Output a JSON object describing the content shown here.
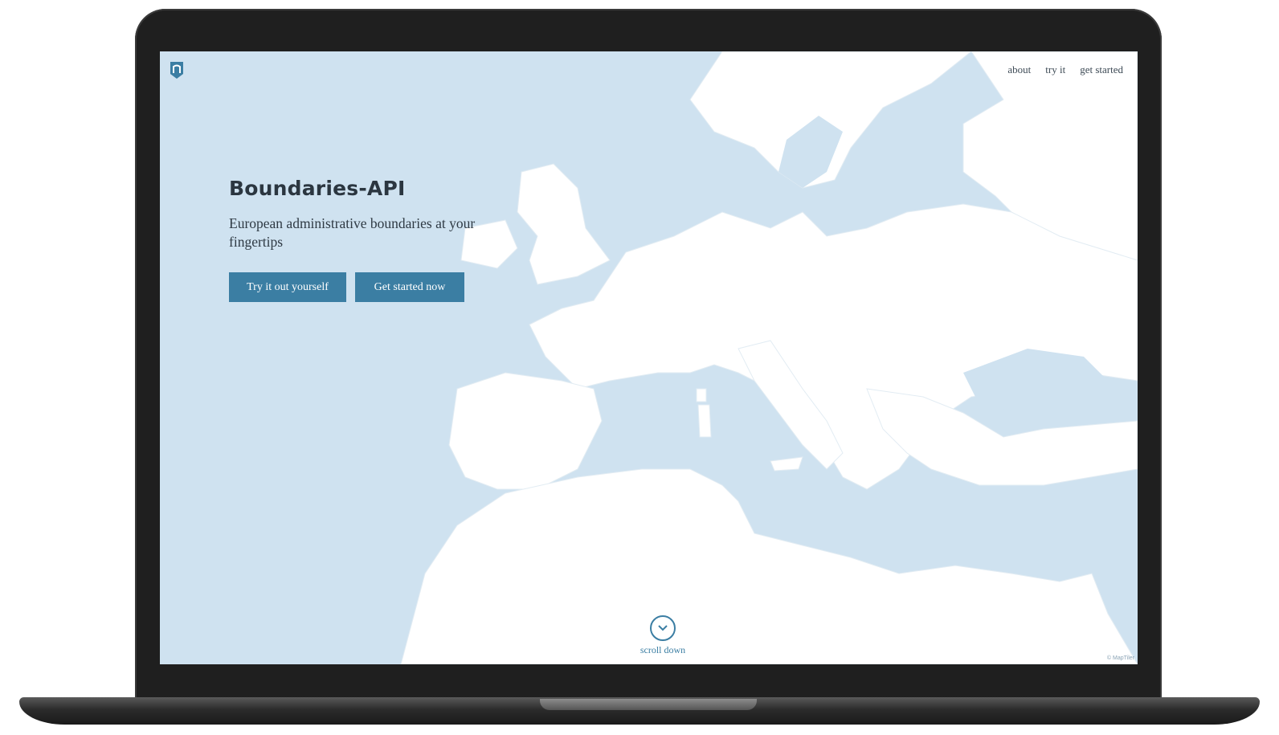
{
  "nav": {
    "about": "about",
    "try_it": "try it",
    "get_started": "get started"
  },
  "hero": {
    "title": "Boundaries-API",
    "subtitle": "European administrative boundaries at your fingertips",
    "button_try": "Try it out yourself",
    "button_start": "Get started now"
  },
  "scroll": {
    "label": "scroll down",
    "icon": "chevron-down-icon"
  },
  "map": {
    "attribution": "© MapTiler"
  },
  "colors": {
    "sea": "#cfe2f0",
    "land": "#ffffff",
    "accent": "#3b7ea3",
    "text": "#2b3640"
  }
}
